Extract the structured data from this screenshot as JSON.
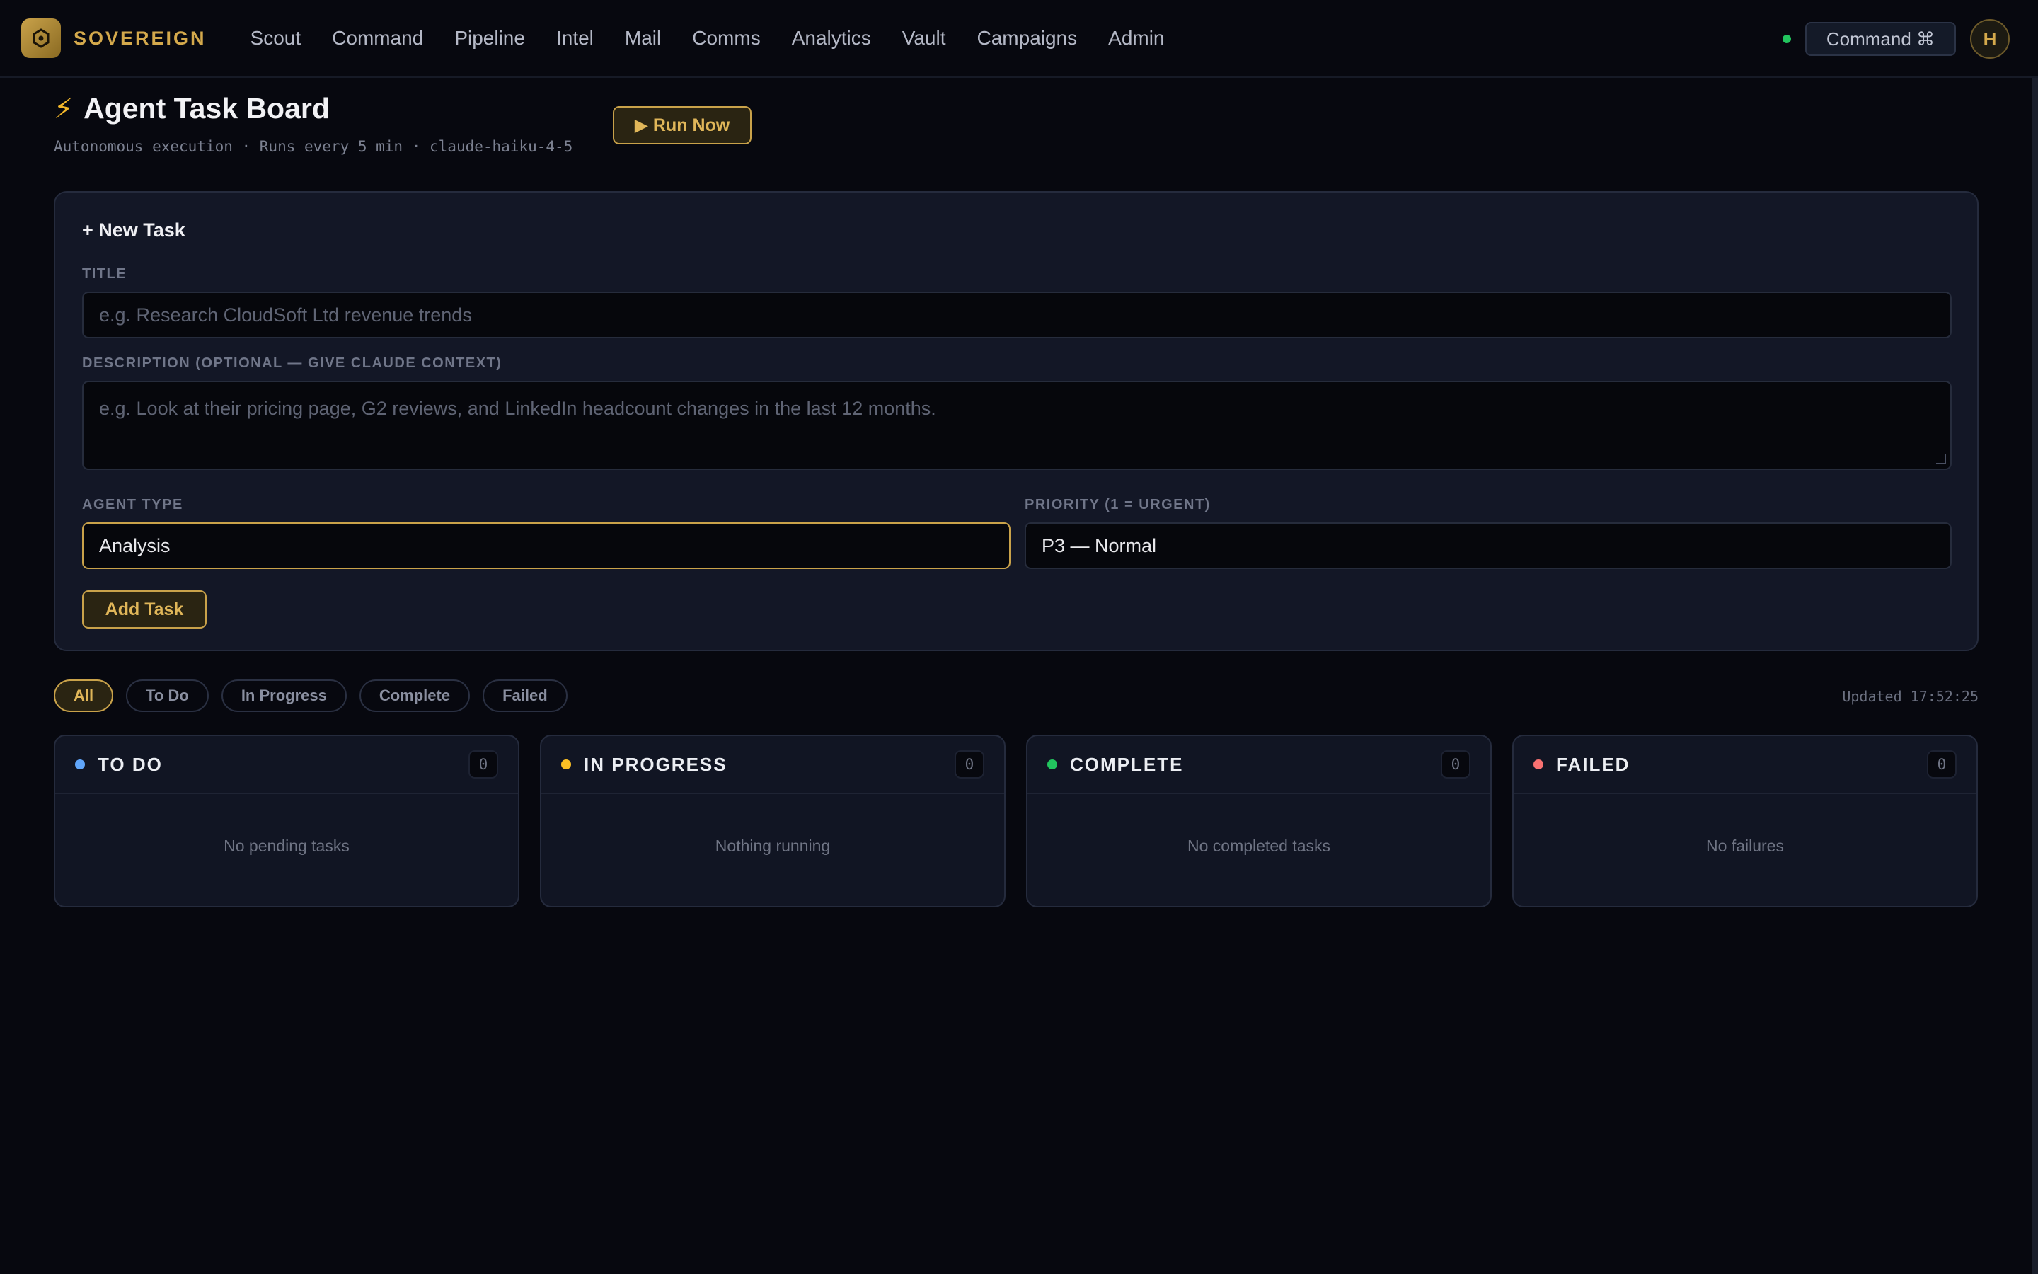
{
  "app": {
    "brand": "SOVEREIGN",
    "nav": [
      "Scout",
      "Command",
      "Pipeline",
      "Intel",
      "Mail",
      "Comms",
      "Analytics",
      "Vault",
      "Campaigns",
      "Admin"
    ],
    "command_button": "Command ⌘",
    "avatar_initial": "H",
    "status_color": "#22c55e"
  },
  "header": {
    "icon": "lightning-icon",
    "title": "Agent Task Board",
    "subtitle": "Autonomous execution · Runs every 5 min · claude-haiku-4-5",
    "run_button": "▶ Run Now"
  },
  "new_task": {
    "heading": "+ New Task",
    "title_label": "TITLE",
    "title_placeholder": "e.g. Research CloudSoft Ltd revenue trends",
    "description_label": "DESCRIPTION (OPTIONAL — GIVE CLAUDE CONTEXT)",
    "description_placeholder": "e.g. Look at their pricing page, G2 reviews, and LinkedIn headcount changes in the last 12 months.",
    "agent_type_label": "AGENT TYPE",
    "agent_type_value": "Analysis",
    "priority_label": "PRIORITY (1 = URGENT)",
    "priority_value": "P3 — Normal",
    "add_button": "Add Task"
  },
  "filters": {
    "items": [
      "All",
      "To Do",
      "In Progress",
      "Complete",
      "Failed"
    ],
    "active": "All",
    "updated": "Updated 17:52:25"
  },
  "columns": [
    {
      "title": "TO DO",
      "count": "0",
      "empty": "No pending tasks",
      "color": "#60a5fa"
    },
    {
      "title": "IN PROGRESS",
      "count": "0",
      "empty": "Nothing running",
      "color": "#fbbf24"
    },
    {
      "title": "COMPLETE",
      "count": "0",
      "empty": "No completed tasks",
      "color": "#22c55e"
    },
    {
      "title": "FAILED",
      "count": "0",
      "empty": "No failures",
      "color": "#f87171"
    }
  ],
  "colors": {
    "accent": "#c9a24a",
    "background": "#07080f",
    "card": "#131726"
  }
}
